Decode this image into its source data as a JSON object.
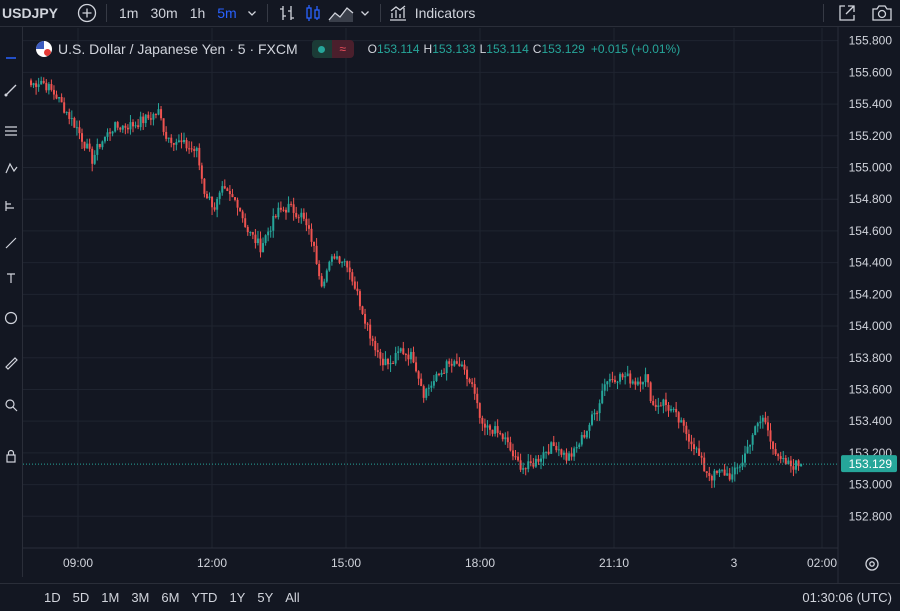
{
  "toolbar": {
    "symbol": "USDJPY",
    "timeframes": [
      "1m",
      "30m",
      "1h",
      "5m"
    ],
    "active_timeframe": "5m",
    "indicators_label": "Indicators"
  },
  "legend": {
    "title": "U.S. Dollar / Japanese Yen · 5 · FXCM",
    "open_key": "O",
    "open": "153.114",
    "high_key": "H",
    "high": "153.133",
    "low_key": "L",
    "low": "153.114",
    "close_key": "C",
    "close": "153.129",
    "change": "+0.015 (+0.01%)"
  },
  "bottom": {
    "ranges": [
      "1D",
      "5D",
      "1M",
      "3M",
      "6M",
      "YTD",
      "1Y",
      "5Y",
      "All"
    ],
    "clock": "01:30:06 (UTC)"
  },
  "colors": {
    "up": "#26a69a",
    "down": "#ef5350",
    "background": "#131722",
    "grid": "#1f2430",
    "accent": "#2962ff"
  },
  "chart_data": {
    "type": "candlestick",
    "interval": "5m",
    "y_ticks": [
      "155.800",
      "155.600",
      "155.400",
      "155.200",
      "155.000",
      "154.800",
      "154.600",
      "154.400",
      "154.200",
      "154.000",
      "153.800",
      "153.600",
      "153.400",
      "153.200",
      "153.000",
      "152.800"
    ],
    "ylim": [
      152.6,
      155.88
    ],
    "x_ticks": [
      "09:00",
      "12:00",
      "15:00",
      "18:00",
      "21:10",
      "3",
      "02:00"
    ],
    "current_price": "153.129",
    "path_points": [
      [
        0,
        155.52
      ],
      [
        4,
        155.55
      ],
      [
        10,
        155.45
      ],
      [
        14,
        155.35
      ],
      [
        18,
        155.25
      ],
      [
        22,
        155.12
      ],
      [
        24,
        155.05
      ],
      [
        27,
        155.15
      ],
      [
        32,
        155.25
      ],
      [
        40,
        155.27
      ],
      [
        47,
        155.32
      ],
      [
        50,
        155.35
      ],
      [
        53,
        155.2
      ],
      [
        59,
        155.15
      ],
      [
        65,
        155.1
      ],
      [
        68,
        154.85
      ],
      [
        72,
        154.75
      ],
      [
        75,
        154.85
      ],
      [
        81,
        154.78
      ],
      [
        85,
        154.6
      ],
      [
        90,
        154.5
      ],
      [
        93,
        154.6
      ],
      [
        97,
        154.72
      ],
      [
        101,
        154.75
      ],
      [
        106,
        154.7
      ],
      [
        110,
        154.55
      ],
      [
        114,
        154.28
      ],
      [
        119,
        154.45
      ],
      [
        124,
        154.4
      ],
      [
        129,
        154.15
      ],
      [
        133,
        153.95
      ],
      [
        137,
        153.8
      ],
      [
        141,
        153.75
      ],
      [
        145,
        153.85
      ],
      [
        150,
        153.8
      ],
      [
        154,
        153.58
      ],
      [
        158,
        153.65
      ],
      [
        163,
        153.75
      ],
      [
        168,
        153.75
      ],
      [
        173,
        153.62
      ],
      [
        177,
        153.35
      ],
      [
        181,
        153.35
      ],
      [
        186,
        153.28
      ],
      [
        190,
        153.15
      ],
      [
        194,
        153.1
      ],
      [
        198,
        153.15
      ],
      [
        202,
        153.22
      ],
      [
        206,
        153.25
      ],
      [
        210,
        153.17
      ],
      [
        213,
        153.2
      ],
      [
        218,
        153.35
      ],
      [
        222,
        153.48
      ],
      [
        225,
        153.65
      ],
      [
        229,
        153.68
      ],
      [
        233,
        153.68
      ],
      [
        237,
        153.65
      ],
      [
        241,
        153.68
      ],
      [
        244,
        153.5
      ],
      [
        248,
        153.52
      ],
      [
        252,
        153.45
      ],
      [
        256,
        153.35
      ],
      [
        260,
        153.25
      ],
      [
        264,
        153.1
      ],
      [
        267,
        153.05
      ],
      [
        271,
        153.08
      ],
      [
        275,
        153.05
      ],
      [
        279,
        153.15
      ],
      [
        283,
        153.32
      ],
      [
        287,
        153.42
      ],
      [
        289,
        153.35
      ],
      [
        293,
        153.15
      ],
      [
        298,
        153.12
      ],
      [
        302,
        153.13
      ]
    ],
    "last_candle": {
      "open": 153.114,
      "high": 153.133,
      "low": 153.114,
      "close": 153.129
    }
  }
}
